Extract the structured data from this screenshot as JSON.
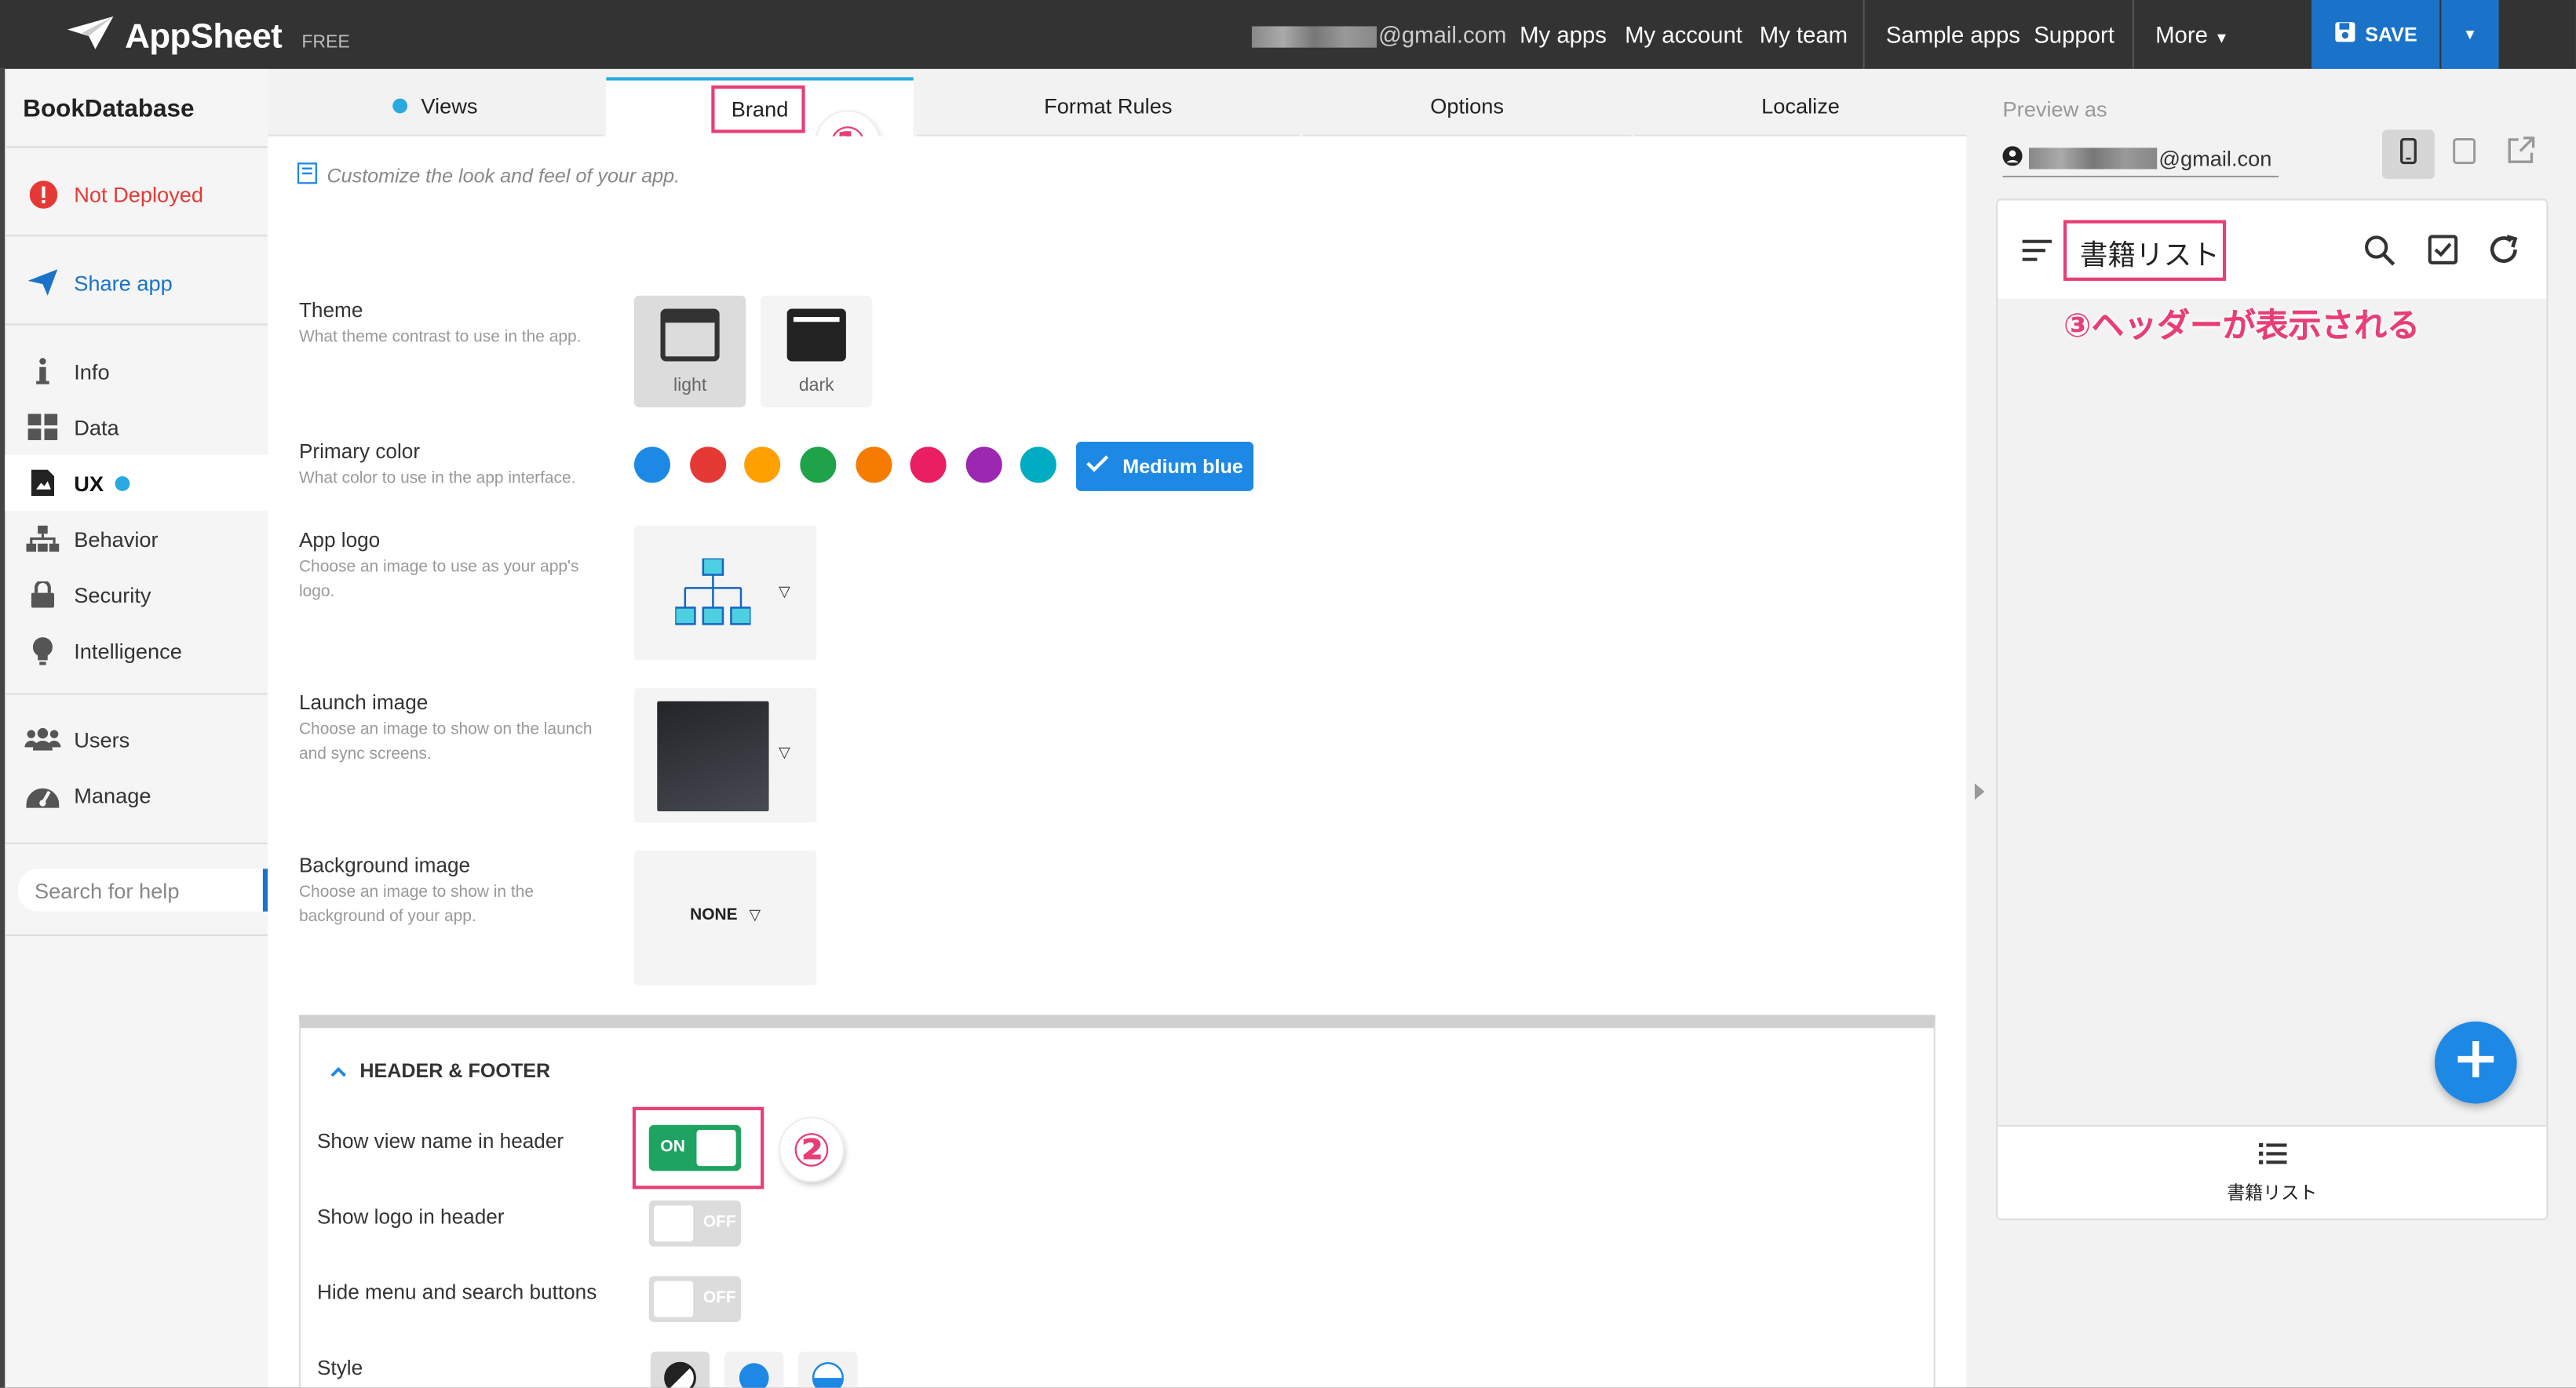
{
  "topbar": {
    "app_name": "AppSheet",
    "plan": "FREE",
    "email_suffix": "@gmail.com",
    "nav": [
      "My apps",
      "My account",
      "My team",
      "Sample apps",
      "Support",
      "More"
    ],
    "save_label": "SAVE",
    "accent_color": "#1a73c8"
  },
  "sidebar": {
    "app_name": "BookDatabase",
    "deploy_status": "Not Deployed",
    "share": "Share app",
    "items": [
      {
        "label": "Info",
        "icon": "info-icon"
      },
      {
        "label": "Data",
        "icon": "grid-icon"
      },
      {
        "label": "UX",
        "icon": "ux-icon"
      },
      {
        "label": "Behavior",
        "icon": "hierarchy-icon"
      },
      {
        "label": "Security",
        "icon": "lock-icon"
      },
      {
        "label": "Intelligence",
        "icon": "bulb-icon"
      }
    ],
    "manage_items": [
      {
        "label": "Users",
        "icon": "users-icon"
      },
      {
        "label": "Manage",
        "icon": "dashboard-icon"
      }
    ],
    "search_placeholder": "Search for help"
  },
  "tabs": [
    "Views",
    "Brand",
    "Format Rules",
    "Options",
    "Localize"
  ],
  "active_tab": "Brand",
  "brand": {
    "hint": "Customize the look and feel of your app.",
    "theme": {
      "label": "Theme",
      "desc": "What theme contrast to use in the app.",
      "options": [
        "light",
        "dark"
      ],
      "selected": "light"
    },
    "primary_color": {
      "label": "Primary color",
      "desc": "What color to use in the app interface.",
      "swatches": [
        "#1e88e5",
        "#e53935",
        "#ffa000",
        "#1ea34a",
        "#f57c00",
        "#e91e63",
        "#9c27b0",
        "#00acc1"
      ],
      "selected": "Medium blue"
    },
    "app_logo": {
      "label": "App logo",
      "desc": "Choose an image to use as your app's logo."
    },
    "launch_image": {
      "label": "Launch image",
      "desc": "Choose an image to show on the launch and sync screens."
    },
    "background_image": {
      "label": "Background image",
      "desc": "Choose an image to show in the background of your app.",
      "value": "NONE"
    }
  },
  "header_footer": {
    "title": "HEADER & FOOTER",
    "rows": [
      {
        "label": "Show view name in header",
        "state": "ON"
      },
      {
        "label": "Show logo in header",
        "state": "OFF"
      },
      {
        "label": "Hide menu and search buttons",
        "state": "OFF"
      }
    ],
    "style_label": "Style"
  },
  "preview": {
    "label": "Preview as",
    "email_suffix": "@gmail.con",
    "header_title": "書籍リスト",
    "footer_label": "書籍リスト"
  },
  "annotations": {
    "n1": "①",
    "n2": "②",
    "n3_text": "③ヘッダーが表示される",
    "color": "#e83e74"
  }
}
